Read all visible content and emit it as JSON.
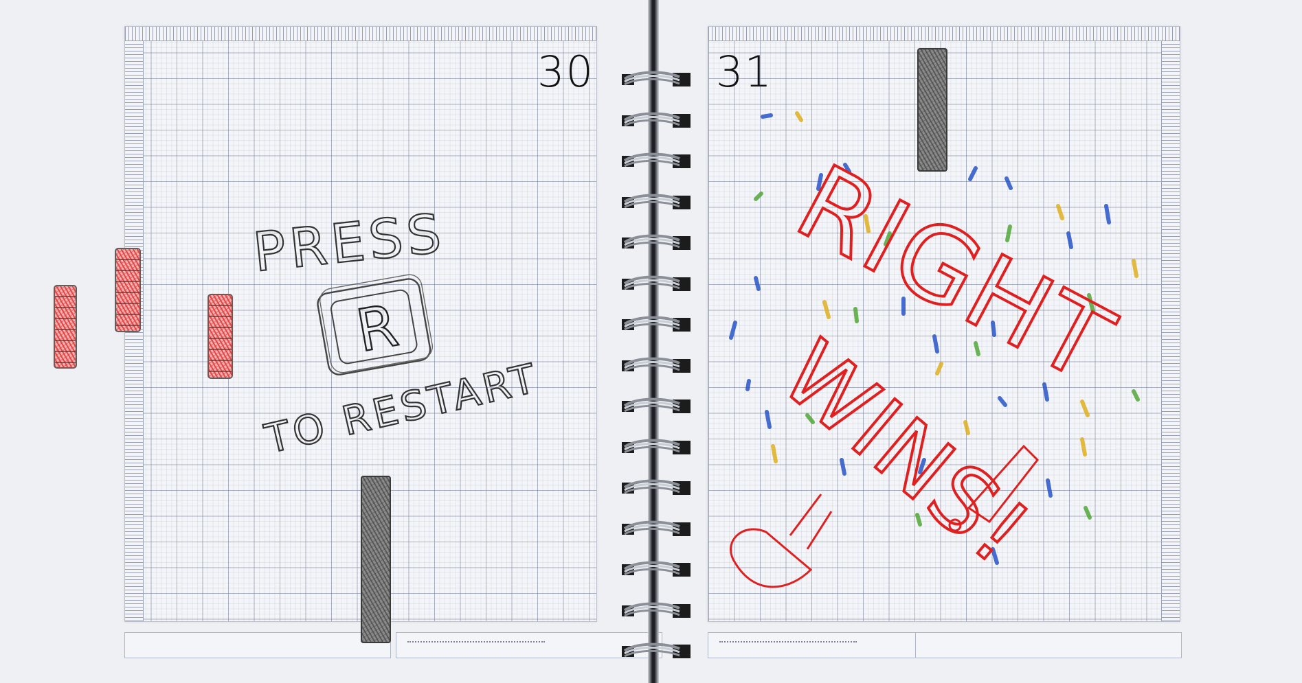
{
  "scoreboard": {
    "left_score": "30",
    "right_score": "31"
  },
  "overlay": {
    "restart_prompt_line1": "PRESS",
    "restart_key": "R",
    "restart_prompt_line2": "TO RESTART",
    "winner_line1": "RIGHT",
    "winner_line2": "WINS!"
  },
  "colors": {
    "winner_text": "#e02020",
    "prompt_text": "#333333",
    "paddle": "#7d7d7d",
    "brick": "#e85a5a",
    "confetti": [
      "#2a55c8",
      "#e0b020",
      "#52a838",
      "#2a55c8"
    ]
  },
  "game": {
    "state": "game-over",
    "winner": "right",
    "restart_key": "R"
  }
}
